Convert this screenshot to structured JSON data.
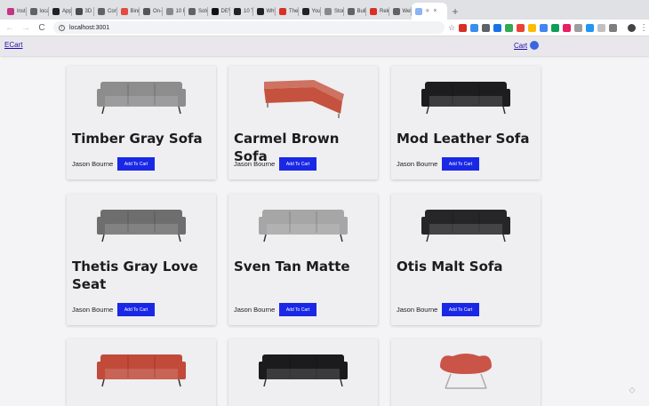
{
  "browser": {
    "tabs": [
      {
        "label": "Insta",
        "icon": "instagram-icon",
        "color": "#c13584"
      },
      {
        "label": "local",
        "icon": "globe-icon",
        "color": "#5f6368"
      },
      {
        "label": "Appli",
        "icon": "medium-icon",
        "color": "#222222"
      },
      {
        "label": "3D I",
        "icon": "cube-icon",
        "color": "#4a4a4a"
      },
      {
        "label": "Conn",
        "icon": "globe-icon",
        "color": "#5f6368"
      },
      {
        "label": "Binn",
        "icon": "app-icon",
        "color": "#e34b3f"
      },
      {
        "label": "On-c",
        "icon": "app-icon",
        "color": "#555555"
      },
      {
        "label": "10 F",
        "icon": "sun-icon",
        "color": "#888888"
      },
      {
        "label": "Solv",
        "icon": "globe-icon",
        "color": "#5f6368"
      },
      {
        "label": "DEV",
        "icon": "dev-icon",
        "color": "#111111"
      },
      {
        "label": "10 Ti",
        "icon": "medium-icon",
        "color": "#222222"
      },
      {
        "label": "Why",
        "icon": "medium-icon",
        "color": "#222222"
      },
      {
        "label": "The I",
        "icon": "app-icon",
        "color": "#d93025"
      },
      {
        "label": "You",
        "icon": "medium-icon",
        "color": "#222222"
      },
      {
        "label": "Story",
        "icon": "doc-icon",
        "color": "#888888"
      },
      {
        "label": "Build",
        "icon": "bolt-icon",
        "color": "#5f6368"
      },
      {
        "label": "Relea",
        "icon": "app-icon",
        "color": "#d93025"
      },
      {
        "label": "Welc",
        "icon": "globe-icon",
        "color": "#5f6368"
      }
    ],
    "active_tab": {
      "label": "⚛",
      "close": "×"
    },
    "new_tab": "+",
    "url": "localhost:3001",
    "back": "←",
    "forward": "→",
    "reload": "C",
    "star": "☆",
    "menu": "⋮"
  },
  "nav": {
    "brand": "ECart",
    "cart_label": "Cart"
  },
  "products": [
    {
      "title": "Timber Gray Sofa",
      "seller": "Jason Bourne",
      "button": "Add To Cart",
      "sofa_color": "#8d8d8d",
      "shape": "sofa"
    },
    {
      "title": "Carmel Brown Sofa",
      "seller": "Jason Bourne",
      "button": "Add To Cart",
      "sofa_color": "#c5523e",
      "shape": "sectional"
    },
    {
      "title": "Mod Leather Sofa",
      "seller": "Jason Bourne",
      "button": "Add To Cart",
      "sofa_color": "#1d1d1f",
      "shape": "sofa"
    },
    {
      "title": "Thetis Gray Love Seat",
      "seller": "Jason Bourne",
      "button": "Add To Cart",
      "sofa_color": "#6f6e6e",
      "shape": "sofa"
    },
    {
      "title": "Sven Tan Matte",
      "seller": "Jason Bourne",
      "button": "Add To Cart",
      "sofa_color": "#a6a6a6",
      "shape": "sofa"
    },
    {
      "title": "Otis Malt Sofa",
      "seller": "Jason Bourne",
      "button": "Add To Cart",
      "sofa_color": "#262628",
      "shape": "sofa"
    },
    {
      "title": "",
      "seller": "",
      "button": "",
      "sofa_color": "#c14a3a",
      "shape": "sofa"
    },
    {
      "title": "",
      "seller": "",
      "button": "",
      "sofa_color": "#1b1b1d",
      "shape": "sofa"
    },
    {
      "title": "",
      "seller": "",
      "button": "",
      "sofa_color": "#c95447",
      "shape": "swan"
    }
  ],
  "colors": {
    "button_bg": "#1a28e6",
    "link": "#1a0dab",
    "page_bg": "#f4f3f5",
    "card_bg": "#efeef1"
  }
}
